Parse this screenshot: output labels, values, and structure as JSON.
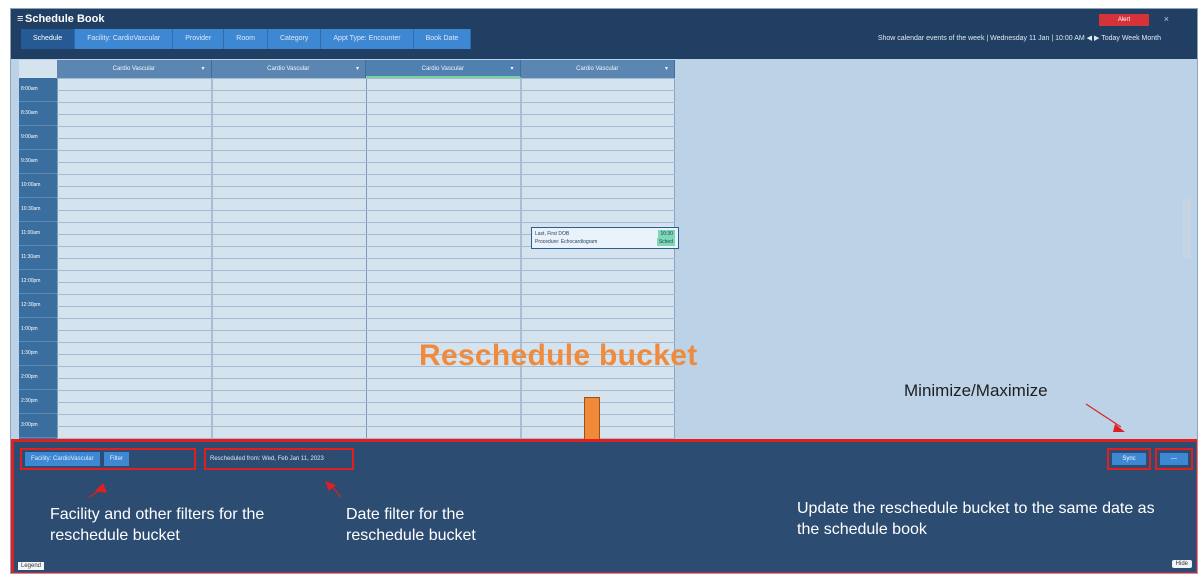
{
  "app": {
    "title": "Schedule Book",
    "menu_icon": "hamburger-icon"
  },
  "tabs": [
    "Schedule",
    "Facility: CardioVascular",
    "Provider",
    "Room",
    "Category",
    "Appt Type: Encounter",
    "Book Date"
  ],
  "header": {
    "right_text": "Show calendar events of the week  |  Wednesday 11 Jan   |  10:00 AM  ◀ ▶ Today Week Month",
    "alert_label": "Alert",
    "close_icon": "close-icon"
  },
  "calendar": {
    "columns": [
      "Cardio Vascular",
      "Cardio Vascular",
      "Cardio Vascular",
      "Cardio Vascular"
    ],
    "selected_column": 2,
    "times": [
      "8:00am",
      "8:30am",
      "9:00am",
      "9:30am",
      "10:00am",
      "10:30am",
      "11:00am",
      "11:30am",
      "12:00pm",
      "12:30pm",
      "1:00pm",
      "1:30pm",
      "2:00pm",
      "2:30pm",
      "3:00pm"
    ],
    "appointment": {
      "line1": "Last, First DOB",
      "line1_tag": "10:30",
      "line2": "Procedure: Echocardiogram",
      "line2_tag": "Sched"
    }
  },
  "annotations": {
    "title": "Reschedule bucket",
    "minmax": "Minimize/Maximize",
    "filters": "Facility and other filters for the reschedule bucket",
    "date": "Date filter for the reschedule bucket",
    "update": "Update the reschedule bucket to the same date as the schedule book",
    "accent_color": "#f08a3c",
    "highlight_color": "#e02020"
  },
  "bucket": {
    "facility_btn": "Facility: CardioVascular",
    "filter_btn": "Filter",
    "date_text": "Rescheduled from: Wed, Feb Jan 11, 2023",
    "update_btn": "Sync",
    "minmax_btn": "—",
    "bottom_left": "Legend",
    "bottom_right": "Hide"
  }
}
